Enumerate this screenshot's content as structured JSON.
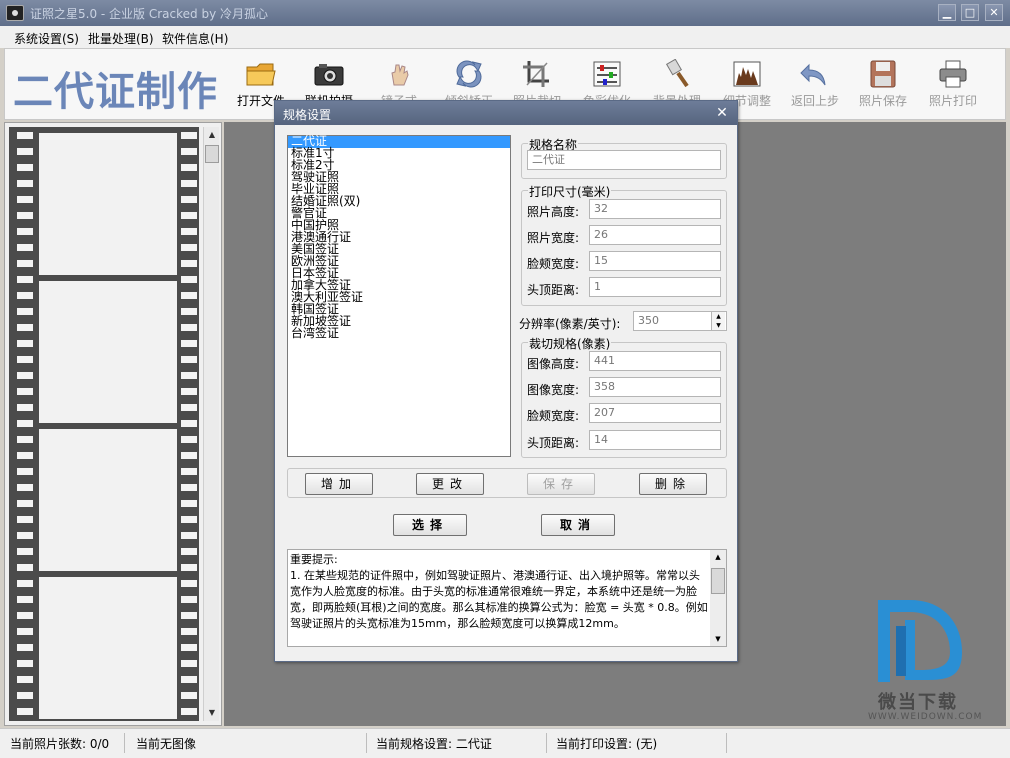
{
  "window": {
    "title": "证照之星5.0 - 企业版 Cracked by 冷月孤心",
    "minimize": "▁",
    "maximize": "□",
    "close": "✕"
  },
  "menu": [
    "系统设置(S)",
    "批量处理(B)",
    "软件信息(H)"
  ],
  "toolbar": {
    "brand": "二代证制作",
    "tools": [
      {
        "label": "打开文件",
        "icon": "folder-icon"
      },
      {
        "label": "联机拍摄",
        "icon": "camera-icon"
      },
      {
        "label": "镜子式",
        "icon": "hand-icon"
      },
      {
        "label": "倾斜矫正",
        "icon": "rotate-icon"
      },
      {
        "label": "照片裁切",
        "icon": "crop-icon"
      },
      {
        "label": "色彩优化",
        "icon": "sliders-icon"
      },
      {
        "label": "背景处理",
        "icon": "brush-icon"
      },
      {
        "label": "细节调整",
        "icon": "histogram-icon"
      },
      {
        "label": "返回上步",
        "icon": "undo-icon"
      },
      {
        "label": "照片保存",
        "icon": "save-icon"
      },
      {
        "label": "照片打印",
        "icon": "printer-icon"
      }
    ]
  },
  "status": {
    "count": "当前照片张数: 0/0",
    "image": "当前无图像",
    "spec": "当前规格设置: 二代证",
    "print": "当前打印设置: (无)"
  },
  "watermark": {
    "text": "微当下载",
    "url": "WWW.WEIDOWN.COM"
  },
  "dialog": {
    "title": "规格设置",
    "close": "✕",
    "specs": [
      "二代证",
      "标准1寸",
      "标准2寸",
      "驾驶证照",
      "毕业证照",
      "结婚证照(双)",
      "警官证",
      "中国护照",
      "港澳通行证",
      "美国签证",
      "欧洲签证",
      "日本签证",
      "加拿大签证",
      "澳大利亚签证",
      "韩国签证",
      "新加坡签证",
      "台湾签证"
    ],
    "name_group": {
      "title": "规格名称",
      "value": "二代证"
    },
    "print_group": {
      "title": "打印尺寸(毫米)",
      "fields": [
        {
          "label": "照片高度:",
          "value": "32"
        },
        {
          "label": "照片宽度:",
          "value": "26"
        },
        {
          "label": "脸颊宽度:",
          "value": "15"
        },
        {
          "label": "头顶距离:",
          "value": "1"
        }
      ]
    },
    "resolution": {
      "label": "分辨率(像素/英寸):",
      "value": "350"
    },
    "crop_group": {
      "title": "裁切规格(像素)",
      "fields": [
        {
          "label": "图像高度:",
          "value": "441"
        },
        {
          "label": "图像宽度:",
          "value": "358"
        },
        {
          "label": "脸颊宽度:",
          "value": "207"
        },
        {
          "label": "头顶距离:",
          "value": "14"
        }
      ]
    },
    "buttons": {
      "add": "增加",
      "edit": "更改",
      "save": "保存",
      "delete": "删除",
      "select": "选择",
      "cancel": "取消"
    },
    "notes": "重要提示:\n1. 在某些规范的证件照中，例如驾驶证照片、港澳通行证、出入境护照等。常常以头宽作为人脸宽度的标准。由于头宽的标准通常很难统一界定，本系统中还是统一为脸宽，即两脸颊(耳根)之间的宽度。那么其标准的换算公式为：脸宽 = 头宽 * 0.8。例如驾驶证照片的头宽标准为15mm，那么脸颊宽度可以换算成12mm。"
  }
}
